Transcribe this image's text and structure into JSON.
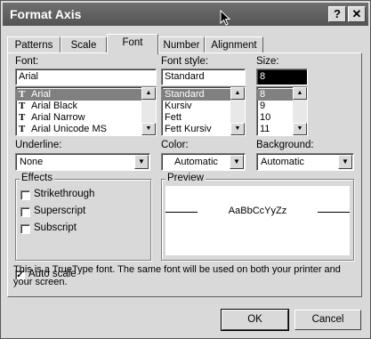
{
  "window": {
    "title": "Format Axis",
    "help_label": "?",
    "close_label": "✕"
  },
  "tabs": [
    {
      "label": "Patterns"
    },
    {
      "label": "Scale"
    },
    {
      "label": "Font"
    },
    {
      "label": "Number"
    },
    {
      "label": "Alignment"
    }
  ],
  "font": {
    "label": "Font:",
    "value": "Arial",
    "options": [
      "Arial",
      "Arial Black",
      "Arial Narrow",
      "Arial Unicode MS"
    ],
    "truetype_glyph": "T"
  },
  "style": {
    "label": "Font style:",
    "value": "Standard",
    "options": [
      "Standard",
      "Kursiv",
      "Fett",
      "Fett Kursiv"
    ]
  },
  "size": {
    "label": "Size:",
    "value": "8",
    "options": [
      "8",
      "9",
      "10",
      "11"
    ]
  },
  "underline": {
    "label": "Underline:",
    "value": "None"
  },
  "color": {
    "label": "Color:",
    "value": "Automatic"
  },
  "background": {
    "label": "Background:",
    "value": "Automatic"
  },
  "effects": {
    "label": "Effects",
    "strikethrough": "Strikethrough",
    "superscript": "Superscript",
    "subscript": "Subscript"
  },
  "preview": {
    "label": "Preview",
    "sample": "AaBbCcYyZz"
  },
  "auto_scale": {
    "label": "Auto scale",
    "checked": true,
    "check_mark": "✓"
  },
  "info_text": "This is a TrueType font.  The same font will be used on both your printer and your screen.",
  "buttons": {
    "ok": "OK",
    "cancel": "Cancel"
  },
  "scroll_arrows": {
    "up": "▲",
    "down": "▼"
  }
}
